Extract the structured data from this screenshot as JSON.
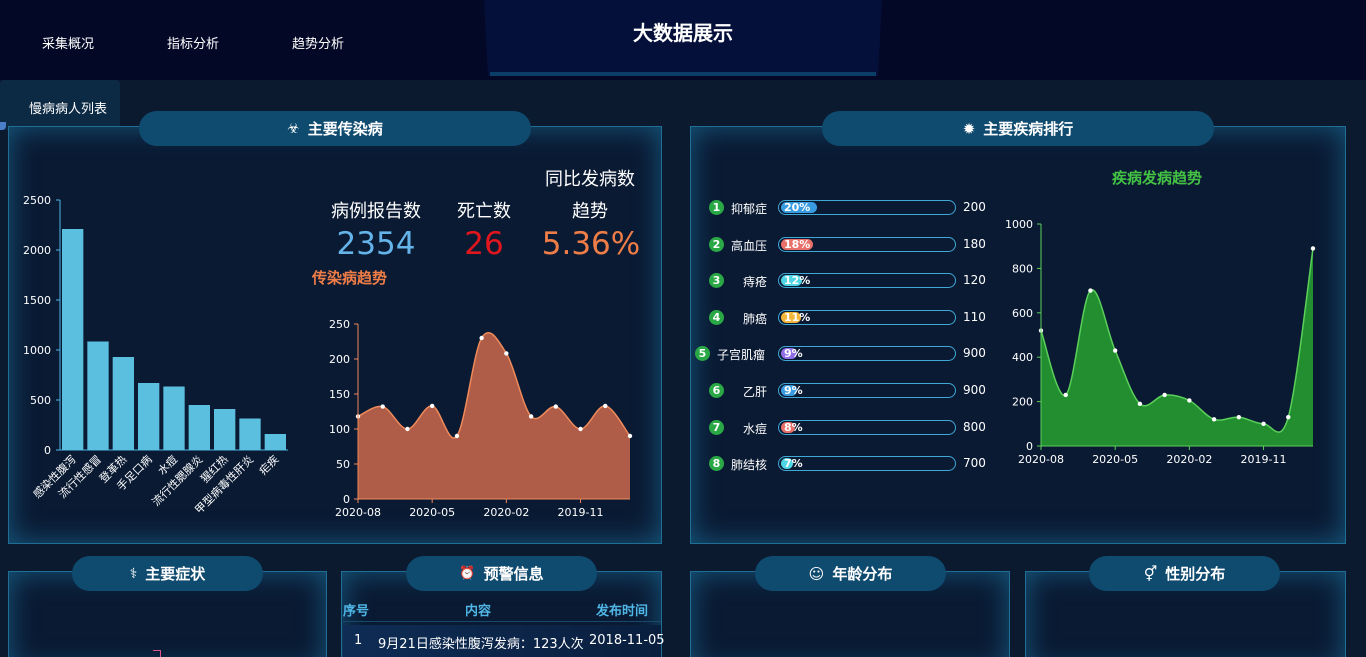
{
  "nav": {
    "items": [
      "采集概况",
      "指标分析",
      "趋势分析"
    ],
    "title": "大数据展示"
  },
  "side_tab": {
    "label": "慢病病人列表"
  },
  "panels": {
    "infectious": {
      "title": "主要传染病",
      "icon": "biohazard-icon"
    },
    "ranking": {
      "title": "主要疾病排行",
      "icon": "virus-icon"
    },
    "symptoms": {
      "title": "主要症状",
      "icon": "stethoscope-icon"
    },
    "warning": {
      "title": "预警信息",
      "icon": "alarm-icon"
    },
    "age": {
      "title": "年龄分布",
      "icon": "head-icon"
    },
    "gender": {
      "title": "性别分布",
      "icon": "gender-icon"
    }
  },
  "stats": {
    "report_label": "病例报告数",
    "death_label": "死亡数",
    "trend_label_1": "同比发病数",
    "trend_label_2": "趋势",
    "report_value": "2354",
    "death_value": "26",
    "trend_value": "5.36%",
    "trend_chart_title": "传染病趋势",
    "colors": {
      "report": "#64b4ea",
      "death": "#e0161d",
      "trend": "#ef7d47"
    }
  },
  "ranking": {
    "items": [
      {
        "rank": "1",
        "name": "抑郁症",
        "pct": "20%",
        "fill": 0.2,
        "value": "200",
        "color": "#3a9ce0"
      },
      {
        "rank": "2",
        "name": "高血压",
        "pct": "18%",
        "fill": 0.18,
        "value": "180",
        "color": "#e8706a"
      },
      {
        "rank": "3",
        "name": "痔疮",
        "pct": "12%",
        "fill": 0.12,
        "value": "120",
        "color": "#4fd4e4"
      },
      {
        "rank": "4",
        "name": "肺癌",
        "pct": "11%",
        "fill": 0.11,
        "value": "110",
        "color": "#f2b63a"
      },
      {
        "rank": "5",
        "name": "子宫肌瘤",
        "pct": "9%",
        "fill": 0.09,
        "value": "900",
        "color": "#8f6ee8"
      },
      {
        "rank": "6",
        "name": "乙肝",
        "pct": "9%",
        "fill": 0.09,
        "value": "900",
        "color": "#3a9ce0"
      },
      {
        "rank": "7",
        "name": "水痘",
        "pct": "8%",
        "fill": 0.08,
        "value": "800",
        "color": "#e8706a"
      },
      {
        "rank": "8",
        "name": "肺结核",
        "pct": "7%",
        "fill": 0.07,
        "value": "700",
        "color": "#4fd4e4"
      }
    ],
    "trend_title": "疾病发病趋势"
  },
  "warning": {
    "headers": [
      "序号",
      "内容",
      "发布时间"
    ],
    "rows": [
      {
        "no": "1",
        "content": "9月21日感染性腹泻发病：123人次",
        "time": "2018-11-05"
      }
    ]
  },
  "chart_data": [
    {
      "type": "bar",
      "categories": [
        "感染性腹泻",
        "流行性感冒",
        "登革热",
        "手足口病",
        "水痘",
        "流行性腮腺炎",
        "猩红热",
        "甲型病毒性肝炎",
        "疟疾"
      ],
      "values": [
        2210,
        1085,
        930,
        670,
        635,
        450,
        410,
        315,
        160
      ],
      "ylim": [
        0,
        2500
      ],
      "yticks": [
        0,
        500,
        1000,
        1500,
        2000,
        2500
      ],
      "color": "#5bbfe0",
      "grid": false
    },
    {
      "type": "area",
      "title": "传染病趋势",
      "x_ticks": [
        "2020-08",
        "2020-05",
        "2020-02",
        "2019-11"
      ],
      "values": [
        118,
        132,
        100,
        133,
        90,
        230,
        208,
        118,
        132,
        100,
        133,
        90
      ],
      "ylim": [
        0,
        250
      ],
      "yticks": [
        0,
        50,
        100,
        150,
        200,
        250
      ],
      "color": "#b8614a",
      "line_color": "#ef8a5a",
      "grid": false
    },
    {
      "type": "area",
      "title": "疾病发病趋势",
      "x_ticks": [
        "2020-08",
        "2020-05",
        "2020-02",
        "2019-11"
      ],
      "values": [
        520,
        230,
        700,
        430,
        190,
        230,
        205,
        120,
        130,
        100,
        130,
        890
      ],
      "ylim": [
        0,
        1000
      ],
      "yticks": [
        0,
        200,
        400,
        600,
        800,
        1000
      ],
      "color": "#249530",
      "line_color": "#5ad05a",
      "grid": false
    }
  ]
}
